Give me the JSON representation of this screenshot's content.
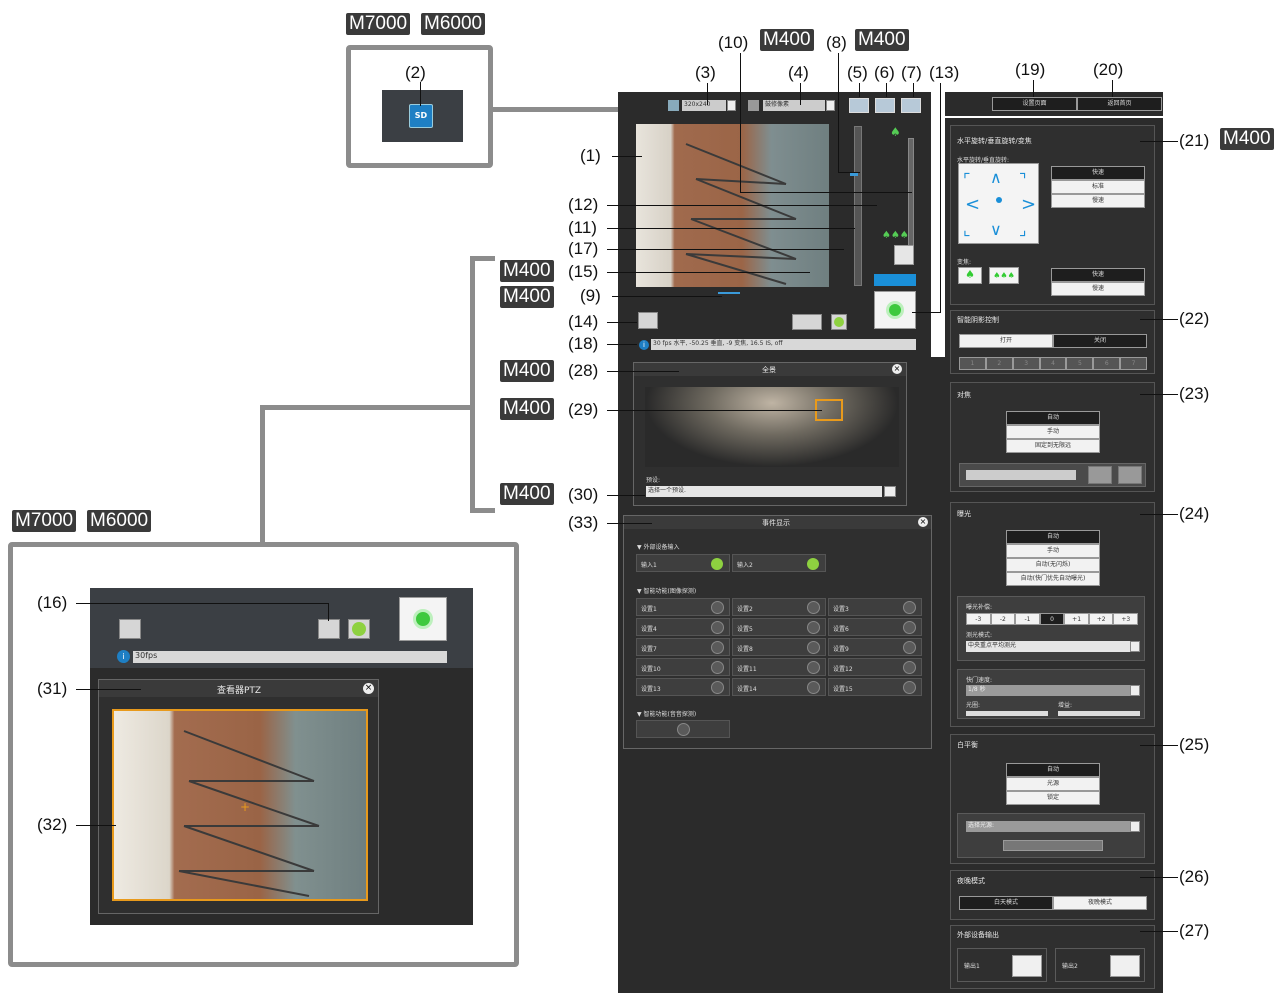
{
  "model_tags": {
    "m7000": "M7000",
    "m6000": "M6000",
    "m400": "M400"
  },
  "callouts": {
    "c1": "(1)",
    "c2": "(2)",
    "c3": "(3)",
    "c4": "(4)",
    "c5": "(5)",
    "c6": "(6)",
    "c7": "(7)",
    "c8": "(8)",
    "c9": "(9)",
    "c10": "(10)",
    "c11": "(11)",
    "c12": "(12)",
    "c13": "(13)",
    "c14": "(14)",
    "c15": "(15)",
    "c16": "(16)",
    "c17": "(17)",
    "c18": "(18)",
    "c19": "(19)",
    "c20": "(20)",
    "c21": "(21)",
    "c22": "(22)",
    "c23": "(23)",
    "c24": "(24)",
    "c25": "(25)",
    "c26": "(26)",
    "c27": "(27)",
    "c28": "(28)",
    "c29": "(29)",
    "c30": "(30)",
    "c31": "(31)",
    "c32": "(32)",
    "c33": "(33)"
  },
  "inset_sd": {
    "sd_label": "SD"
  },
  "viewer": {
    "video_size": "320x240",
    "image_quality": "鼓修像素",
    "status_bar": "30 fps 水平, -50.25 垂直, -9 变焦, 16.5 IS, off"
  },
  "top_buttons": {
    "settings_page": "设置页面",
    "home_page": "返回首页"
  },
  "ptz_panel": {
    "title": "水平旋转/垂直旋转/变焦",
    "pan_tilt_label": "水平旋转/垂直旋转:",
    "speeds": [
      "快速",
      "标准",
      "慢速"
    ],
    "zoom_label": "变焦:",
    "zoom_speeds": [
      "快速",
      "慢速"
    ]
  },
  "smart_shade": {
    "title": "智能阴影控制",
    "on": "打开",
    "off": "关闭",
    "levels": [
      "1",
      "2",
      "3",
      "4",
      "5",
      "6",
      "7"
    ]
  },
  "focus": {
    "title": "对焦",
    "options": [
      "自动",
      "手动",
      "固定到无限远"
    ]
  },
  "exposure": {
    "title": "曝光",
    "options": [
      "自动",
      "手动",
      "自动(无闪烁)",
      "自动(快门优先自动曝光)"
    ],
    "compensation_label": "曝光补偿:",
    "compensation_values": [
      "-3",
      "-2",
      "-1",
      "0",
      "+1",
      "+2",
      "+3"
    ],
    "metering_label": "测光模式:",
    "metering_value": "中央重点平均测光",
    "shutter_label": "快门速度:",
    "shutter_value": "1/8 秒",
    "aperture_label": "光圈:",
    "gain_label": "增益:"
  },
  "white_balance": {
    "title": "白平衡",
    "options": [
      "自动",
      "光源",
      "锁定"
    ],
    "source_placeholder": "选择光源:"
  },
  "day_night": {
    "title": "夜晚模式",
    "day": "白天模式",
    "night": "夜晚模式"
  },
  "ext_output": {
    "title": "外部设备输出",
    "out1": "输出1",
    "out2": "输出2"
  },
  "panorama": {
    "title": "全景",
    "preset_label": "预设:",
    "preset_value": "选择一个预设."
  },
  "event_display": {
    "title": "事件显示",
    "ext_input_heading": "▼ 外部设备输入",
    "inputs": [
      "输入1",
      "输入2"
    ],
    "video_detect_heading": "▼ 智能功能(图像探测)",
    "settings": [
      "设置1",
      "设置2",
      "设置3",
      "设置4",
      "设置5",
      "设置6",
      "设置7",
      "设置8",
      "设置9",
      "设置10",
      "设置11",
      "设置12",
      "设置13",
      "设置14",
      "设置15"
    ],
    "audio_detect_heading": "▼ 智能功能(音音探测)"
  },
  "inset_bottom": {
    "status_bar": "30fps",
    "ptz_viewer_title": "查看器PTZ"
  },
  "colors": {
    "ui_dark": "#2b2b2b",
    "frame_gray": "#8c8c8c",
    "accent_blue": "#1a8fd8",
    "green": "#3ec93e",
    "orange_frame": "#e89a1c"
  }
}
